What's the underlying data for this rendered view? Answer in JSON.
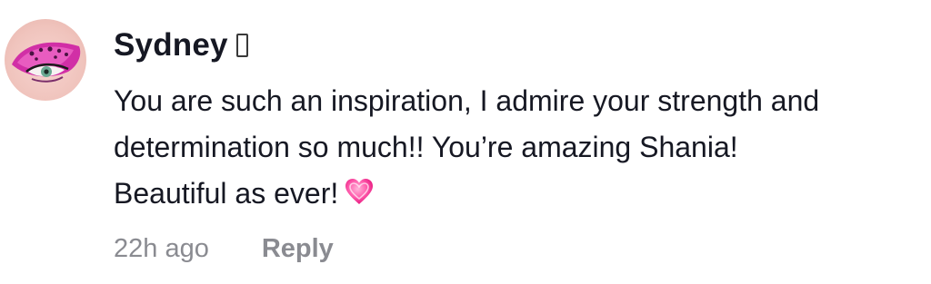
{
  "comment": {
    "author": "Sydney",
    "text_lines": [
      "You are such an inspiration, I admire your strength and",
      "determination so much!! You’re amazing Shania!",
      "Beautiful as ever!"
    ],
    "emoji": "heart-emoji",
    "timestamp": "22h ago",
    "reply_label": "Reply"
  },
  "colors": {
    "text": "#161823",
    "meta": "#8a8b91",
    "heart": "#ff4fa3",
    "avatar_eyeshadow": "#d12fa6"
  },
  "icons": {
    "avatar": "eye-makeup-avatar",
    "badge": "missing-glyph-badge"
  }
}
